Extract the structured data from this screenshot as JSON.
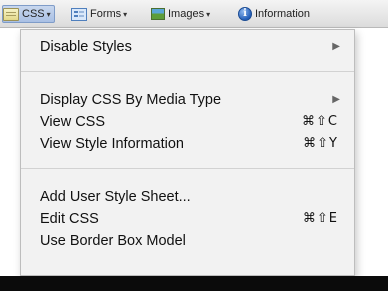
{
  "toolbar": {
    "css_label": "CSS",
    "forms_label": "Forms",
    "images_label": "Images",
    "information_label": "Information",
    "info_glyph": "i",
    "dropdown_glyph": "▾"
  },
  "menu": {
    "items": [
      {
        "label": "Disable Styles",
        "submenu": true
      },
      {
        "label": "Display CSS By Media Type",
        "submenu": true
      },
      {
        "label": "View CSS",
        "shortcut": "⌘⇧C"
      },
      {
        "label": "View Style Information",
        "shortcut": "⌘⇧Y"
      },
      {
        "label": "Add User Style Sheet..."
      },
      {
        "label": "Edit CSS",
        "shortcut": "⌘⇧E"
      },
      {
        "label": "Use Border Box Model"
      }
    ],
    "submenu_glyph": "▶"
  },
  "colors": {
    "menu_background": "#f2f2f2",
    "css_button_highlight": "#a9c0e4",
    "bottom_bar": "#0b0b0b"
  }
}
